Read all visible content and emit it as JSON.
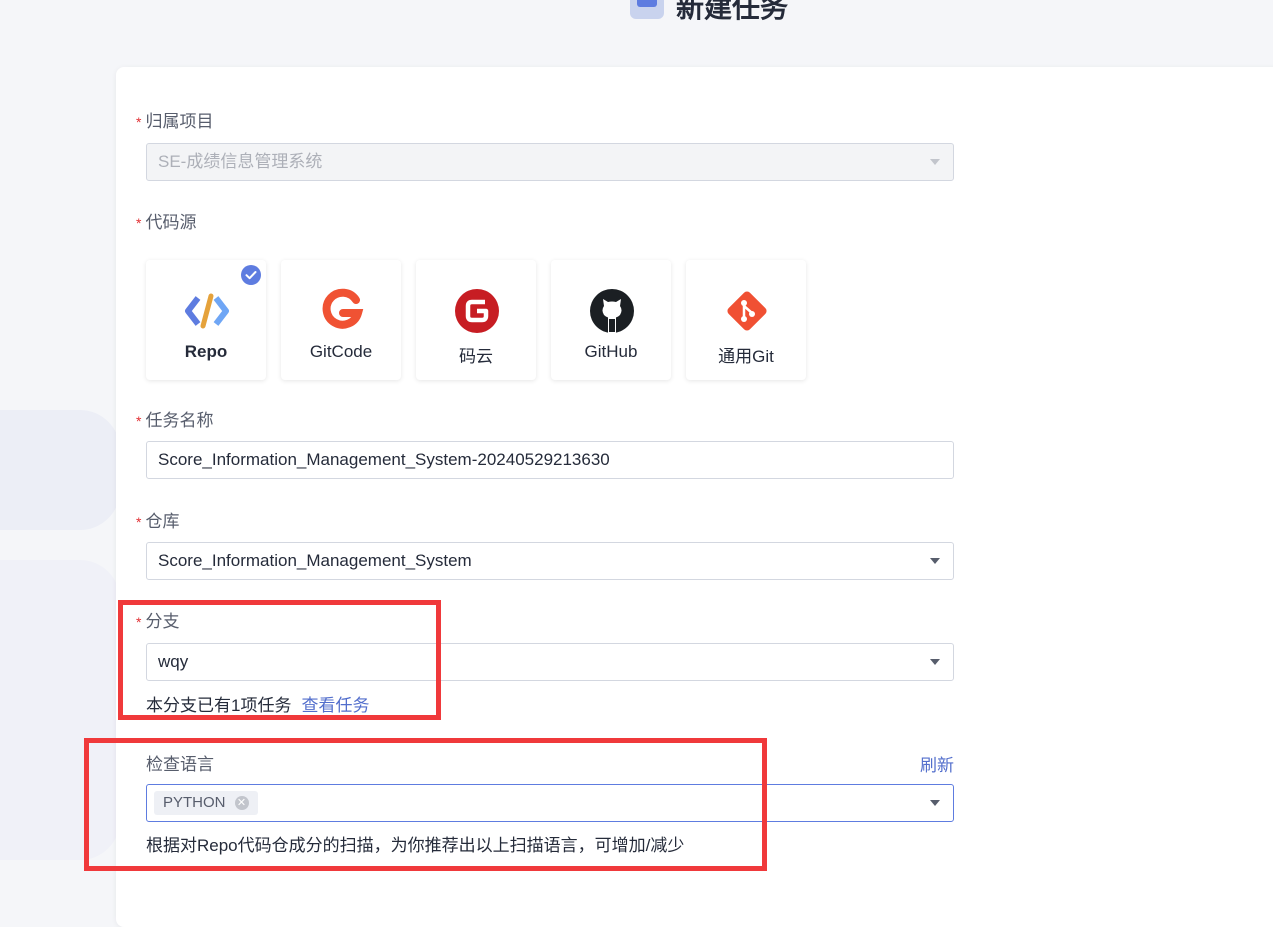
{
  "page": {
    "title": "新建任务"
  },
  "form": {
    "project": {
      "label": "归属项目",
      "value": "SE-成绩信息管理系统"
    },
    "source": {
      "label": "代码源",
      "options": [
        {
          "name": "Repo",
          "icon": "repo-icon",
          "selected": true
        },
        {
          "name": "GitCode",
          "icon": "gitcode-icon",
          "selected": false
        },
        {
          "name": "码云",
          "icon": "gitee-icon",
          "selected": false
        },
        {
          "name": "GitHub",
          "icon": "github-icon",
          "selected": false
        },
        {
          "name": "通用Git",
          "icon": "git-icon",
          "selected": false
        }
      ]
    },
    "task_name": {
      "label": "任务名称",
      "value": "Score_Information_Management_System-20240529213630"
    },
    "repository": {
      "label": "仓库",
      "value": "Score_Information_Management_System"
    },
    "branch": {
      "label": "分支",
      "value": "wqy",
      "hint": "本分支已有1项任务",
      "hint_link": "查看任务"
    },
    "language": {
      "label": "检查语言",
      "refresh": "刷新",
      "tags": [
        "PYTHON"
      ],
      "hint": "根据对Repo代码仓成分的扫描，为你推荐出以上扫描语言，可增加/减少"
    }
  },
  "colors": {
    "primary": "#5e7ce0",
    "link": "#526ecc",
    "required": "#e12f33",
    "highlight_box": "#f0393b"
  }
}
